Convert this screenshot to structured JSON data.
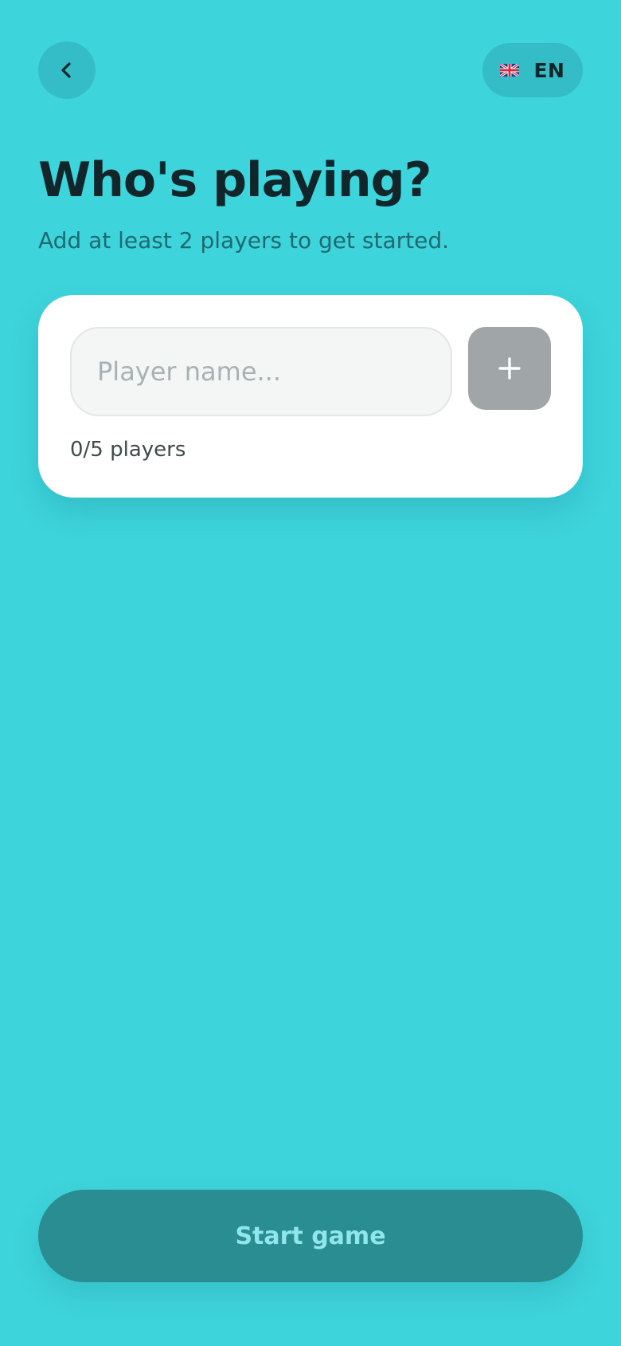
{
  "header": {
    "back_icon": "chevron-left-icon",
    "language": {
      "flag_icon": "uk-flag-icon",
      "code": "EN"
    }
  },
  "main": {
    "title": "Who's playing?",
    "subtitle": "Add at least 2 players to get started."
  },
  "player_form": {
    "input_value": "",
    "input_placeholder": "Player name...",
    "add_icon": "plus-icon",
    "count_text": "0/5 players",
    "players_added": 0,
    "max_players": 5
  },
  "footer": {
    "start_label": "Start game"
  },
  "colors": {
    "background": "#3ED4DC",
    "pill_background": "#34BDC6",
    "title": "#10262A",
    "subtitle": "#1E6A70",
    "card": "#FFFFFF",
    "add_button_disabled": "#A0A6A7",
    "start_button_disabled": "#2A8D92",
    "start_label_disabled": "#8FE6EC"
  }
}
